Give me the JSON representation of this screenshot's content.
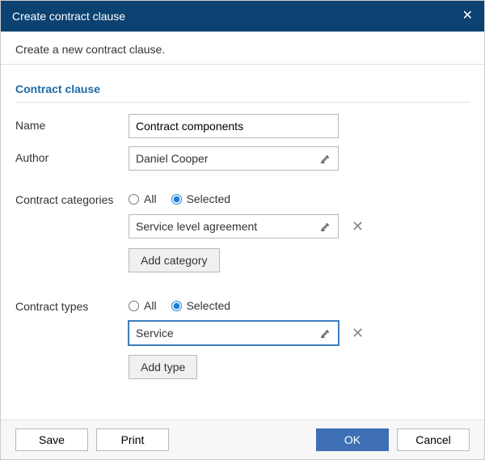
{
  "title": "Create contract clause",
  "subtitle": "Create a new contract clause.",
  "section_title": "Contract clause",
  "labels": {
    "name": "Name",
    "author": "Author",
    "categories": "Contract categories",
    "types": "Contract types"
  },
  "fields": {
    "name_value": "Contract components",
    "author_value": "Daniel Cooper",
    "categories_radio_all": "All",
    "categories_radio_selected": "Selected",
    "categories_selected_value": "Service level agreement",
    "add_category_label": "Add category",
    "types_radio_all": "All",
    "types_radio_selected": "Selected",
    "types_selected_value": "Service",
    "add_type_label": "Add type"
  },
  "buttons": {
    "save": "Save",
    "print": "Print",
    "ok": "OK",
    "cancel": "Cancel"
  }
}
